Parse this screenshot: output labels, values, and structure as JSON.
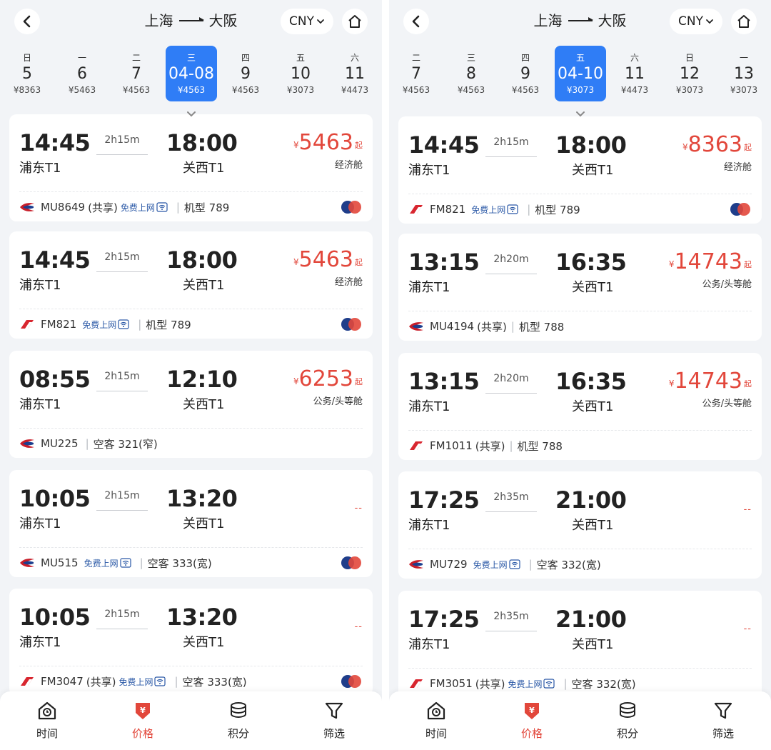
{
  "panels": [
    {
      "route": {
        "from": "上海",
        "to": "大阪"
      },
      "currency": "CNY",
      "dates": [
        {
          "weekday": "日",
          "day": "5",
          "price": "¥8363",
          "selected": false
        },
        {
          "weekday": "一",
          "day": "6",
          "price": "¥5463",
          "selected": false
        },
        {
          "weekday": "二",
          "day": "7",
          "price": "¥4563",
          "selected": false
        },
        {
          "weekday": "三",
          "day": "04-08",
          "price": "¥4563",
          "selected": true
        },
        {
          "weekday": "四",
          "day": "9",
          "price": "¥4563",
          "selected": false
        },
        {
          "weekday": "五",
          "day": "10",
          "price": "¥3073",
          "selected": false
        },
        {
          "weekday": "六",
          "day": "11",
          "price": "¥4473",
          "selected": false
        }
      ],
      "flights": [
        {
          "dep_time": "14:45",
          "dep_airport": "浦东T1",
          "duration": "2h15m",
          "arr_time": "18:00",
          "arr_airport": "关西T1",
          "price": "5463",
          "cabin": "经济舱",
          "airline": "MU",
          "flight_no": "MU8649",
          "share": "(共享)",
          "wifi": "免费上网",
          "aircraft": "机型 789",
          "pay_icon": true
        },
        {
          "dep_time": "14:45",
          "dep_airport": "浦东T1",
          "duration": "2h15m",
          "arr_time": "18:00",
          "arr_airport": "关西T1",
          "price": "5463",
          "cabin": "经济舱",
          "airline": "FM",
          "flight_no": "FM821",
          "share": "",
          "wifi": "免费上网",
          "aircraft": "机型 789",
          "pay_icon": true
        },
        {
          "dep_time": "08:55",
          "dep_airport": "浦东T1",
          "duration": "2h15m",
          "arr_time": "12:10",
          "arr_airport": "关西T1",
          "price": "6253",
          "cabin": "公务/头等舱",
          "airline": "MU",
          "flight_no": "MU225",
          "share": "",
          "wifi": "",
          "aircraft": "空客 321(窄)",
          "pay_icon": false
        },
        {
          "dep_time": "10:05",
          "dep_airport": "浦东T1",
          "duration": "2h15m",
          "arr_time": "13:20",
          "arr_airport": "关西T1",
          "price": "",
          "no_price": "--",
          "cabin": "",
          "airline": "MU",
          "flight_no": "MU515",
          "share": "",
          "wifi": "免费上网",
          "aircraft": "空客 333(宽)",
          "pay_icon": true
        },
        {
          "dep_time": "10:05",
          "dep_airport": "浦东T1",
          "duration": "2h15m",
          "arr_time": "13:20",
          "arr_airport": "关西T1",
          "price": "",
          "no_price": "--",
          "cabin": "",
          "airline": "FM",
          "flight_no": "FM3047",
          "share": "(共享)",
          "wifi": "免费上网",
          "aircraft": "空客 333(宽)",
          "pay_icon": true
        }
      ]
    },
    {
      "route": {
        "from": "上海",
        "to": "大阪"
      },
      "currency": "CNY",
      "dates": [
        {
          "weekday": "二",
          "day": "7",
          "price": "¥4563",
          "selected": false
        },
        {
          "weekday": "三",
          "day": "8",
          "price": "¥4563",
          "selected": false
        },
        {
          "weekday": "四",
          "day": "9",
          "price": "¥4563",
          "selected": false
        },
        {
          "weekday": "五",
          "day": "04-10",
          "price": "¥3073",
          "selected": true
        },
        {
          "weekday": "六",
          "day": "11",
          "price": "¥4473",
          "selected": false
        },
        {
          "weekday": "日",
          "day": "12",
          "price": "¥3073",
          "selected": false
        },
        {
          "weekday": "一",
          "day": "13",
          "price": "¥3073",
          "selected": false
        }
      ],
      "flights": [
        {
          "dep_time": "14:45",
          "dep_airport": "浦东T1",
          "duration": "2h15m",
          "arr_time": "18:00",
          "arr_airport": "关西T1",
          "price": "8363",
          "cabin": "经济舱",
          "airline": "FM",
          "flight_no": "FM821",
          "share": "",
          "wifi": "免费上网",
          "aircraft": "机型 789",
          "pay_icon": true
        },
        {
          "dep_time": "13:15",
          "dep_airport": "浦东T1",
          "duration": "2h20m",
          "arr_time": "16:35",
          "arr_airport": "关西T1",
          "price": "14743",
          "cabin": "公务/头等舱",
          "airline": "MU",
          "flight_no": "MU4194",
          "share": "(共享)",
          "wifi": "",
          "aircraft": "机型 788",
          "pay_icon": false
        },
        {
          "dep_time": "13:15",
          "dep_airport": "浦东T1",
          "duration": "2h20m",
          "arr_time": "16:35",
          "arr_airport": "关西T1",
          "price": "14743",
          "cabin": "公务/头等舱",
          "airline": "FM",
          "flight_no": "FM1011",
          "share": "(共享)",
          "wifi": "",
          "aircraft": "机型 788",
          "pay_icon": false
        },
        {
          "dep_time": "17:25",
          "dep_airport": "浦东T1",
          "duration": "2h35m",
          "arr_time": "21:00",
          "arr_airport": "关西T1",
          "price": "",
          "no_price": "--",
          "cabin": "",
          "airline": "MU",
          "flight_no": "MU729",
          "share": "",
          "wifi": "免费上网",
          "aircraft": "空客 332(宽)",
          "pay_icon": false
        },
        {
          "dep_time": "17:25",
          "dep_airport": "浦东T1",
          "duration": "2h35m",
          "arr_time": "21:00",
          "arr_airport": "关西T1",
          "price": "",
          "no_price": "--",
          "cabin": "",
          "airline": "FM",
          "flight_no": "FM3051",
          "share": "(共享)",
          "wifi": "免费上网",
          "aircraft": "空客 332(宽)",
          "pay_icon": false
        }
      ]
    }
  ],
  "price_prefix": "¥",
  "price_suffix": "起",
  "bottom_nav": [
    {
      "label": "时间",
      "icon": "clock-house-icon",
      "active": false
    },
    {
      "label": "价格",
      "icon": "price-tag-icon",
      "active": true
    },
    {
      "label": "积分",
      "icon": "coins-icon",
      "active": false
    },
    {
      "label": "筛选",
      "icon": "filter-icon",
      "active": false
    }
  ],
  "colors": {
    "accent": "#2f7df6",
    "price": "#e2473b",
    "background": "#f2f4f7"
  }
}
